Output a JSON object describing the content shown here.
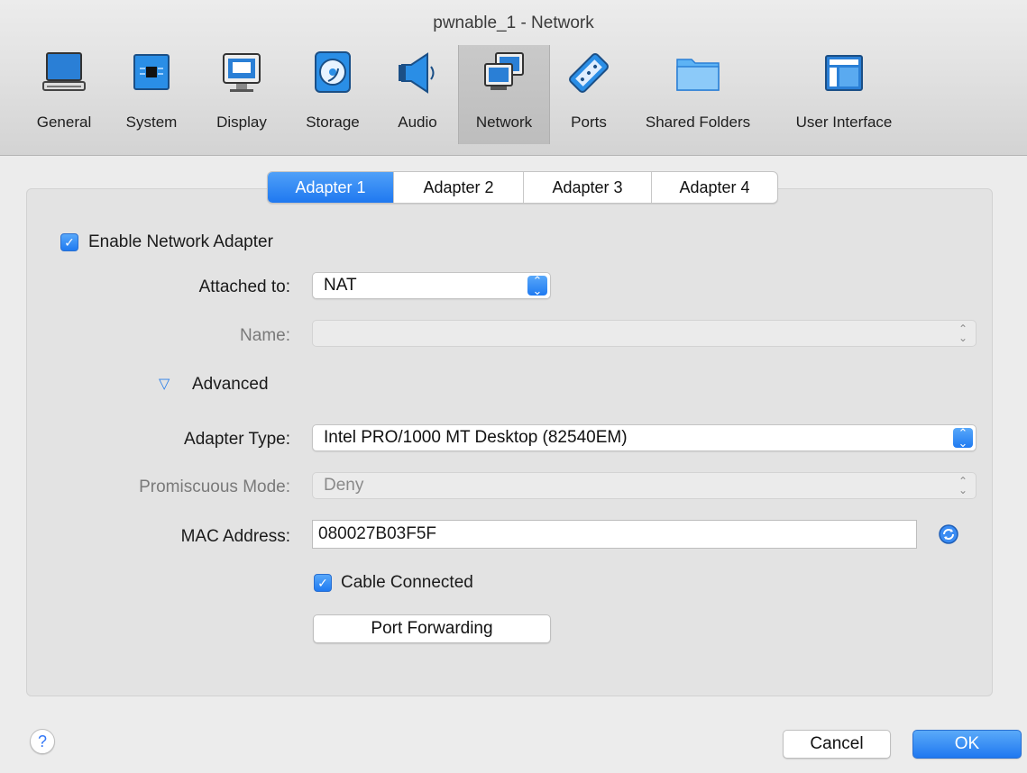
{
  "window": {
    "title": "pwnable_1 - Network"
  },
  "toolbar": {
    "items": [
      {
        "label": "General",
        "icon": "general-icon"
      },
      {
        "label": "System",
        "icon": "system-chip-icon"
      },
      {
        "label": "Display",
        "icon": "display-monitor-icon"
      },
      {
        "label": "Storage",
        "icon": "storage-disk-icon"
      },
      {
        "label": "Audio",
        "icon": "audio-speaker-icon"
      },
      {
        "label": "Network",
        "icon": "network-icon",
        "selected": true
      },
      {
        "label": "Ports",
        "icon": "ports-connector-icon"
      },
      {
        "label": "Shared Folders",
        "icon": "folder-icon"
      },
      {
        "label": "User Interface",
        "icon": "user-interface-window-icon"
      }
    ]
  },
  "tabs": [
    {
      "label": "Adapter 1",
      "selected": true
    },
    {
      "label": "Adapter 2"
    },
    {
      "label": "Adapter 3"
    },
    {
      "label": "Adapter 4"
    }
  ],
  "form": {
    "enable_adapter": {
      "label": "Enable Network Adapter",
      "checked": true
    },
    "attached_to": {
      "label": "Attached to:",
      "value": "NAT"
    },
    "name": {
      "label": "Name:",
      "value": ""
    },
    "advanced": {
      "label": "Advanced",
      "expanded": true
    },
    "adapter_type": {
      "label": "Adapter Type:",
      "value": "Intel PRO/1000 MT Desktop (82540EM)"
    },
    "promiscuous_mode": {
      "label": "Promiscuous Mode:",
      "value": "Deny"
    },
    "mac_address": {
      "label": "MAC Address:",
      "value": "080027B03F5F",
      "refresh_icon": "refresh-mac-icon"
    },
    "cable_connected": {
      "label": "Cable Connected",
      "checked": true
    },
    "port_forwarding": {
      "label": "Port Forwarding"
    }
  },
  "footer": {
    "help": "?",
    "cancel": "Cancel",
    "ok": "OK"
  },
  "colors": {
    "accent": "#1f78f0",
    "background": "#ececec"
  }
}
